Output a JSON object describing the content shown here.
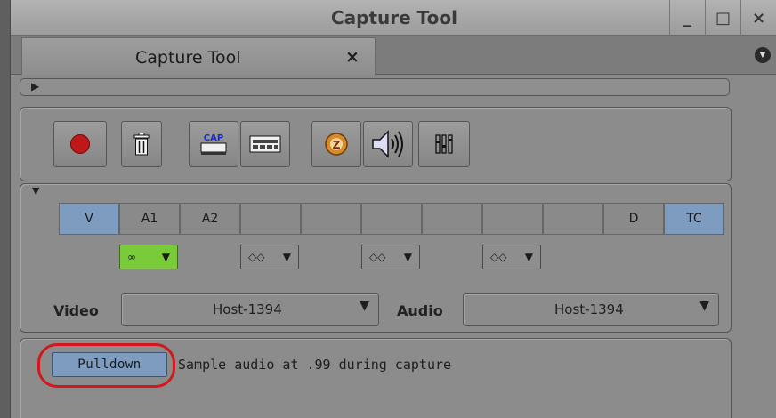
{
  "window": {
    "title": "Capture Tool",
    "minimize_glyph": "_",
    "maximize_glyph": "□",
    "close_glyph": "×"
  },
  "tabs": [
    {
      "label": "Capture Tool",
      "close_glyph": "×",
      "active": true
    }
  ],
  "toolbar": {
    "buttons": [
      {
        "name": "record",
        "icon": "record-icon"
      },
      {
        "name": "trash",
        "icon": "trash-icon"
      },
      {
        "name": "capture",
        "icon": "cap-icon",
        "icon_text": "CAP"
      },
      {
        "name": "deck",
        "icon": "deck-icon"
      },
      {
        "name": "tape",
        "icon": "tape-icon",
        "icon_text": "Z"
      },
      {
        "name": "audio",
        "icon": "speaker-icon"
      },
      {
        "name": "mixer",
        "icon": "mixer-icon"
      }
    ],
    "record_color": "#c01818"
  },
  "tracks": {
    "items": [
      {
        "label": "V",
        "selected": true
      },
      {
        "label": "A1",
        "selected": false
      },
      {
        "label": "A2",
        "selected": false
      },
      {
        "label": "",
        "selected": false
      },
      {
        "label": "",
        "selected": false
      },
      {
        "label": "",
        "selected": false
      },
      {
        "label": "",
        "selected": false
      },
      {
        "label": "",
        "selected": false
      },
      {
        "label": "",
        "selected": false
      },
      {
        "label": "D",
        "selected": false
      },
      {
        "label": "TC",
        "selected": true
      }
    ],
    "selected_color": "#7d9cc0"
  },
  "audio_pairs": [
    {
      "glyph": "∞",
      "active": true
    },
    {
      "glyph": "◇◇",
      "active": false
    },
    {
      "glyph": "◇◇",
      "active": false
    },
    {
      "glyph": "◇◇",
      "active": false
    }
  ],
  "sources": {
    "video_label": "Video",
    "video_value": "Host-1394",
    "audio_label": "Audio",
    "audio_value": "Host-1394"
  },
  "pulldown": {
    "button_label": "Pulldown",
    "description": "Sample audio at .99 during capture",
    "highlight_color": "#d4171c"
  }
}
